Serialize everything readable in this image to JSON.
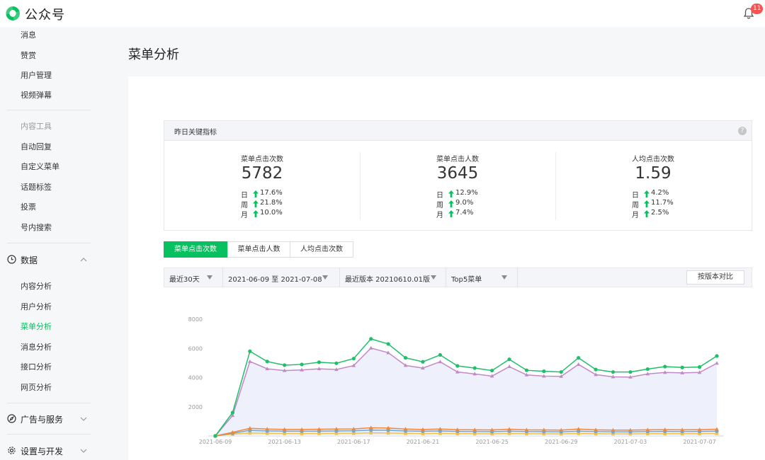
{
  "header": {
    "brand": "公众号",
    "notification_count": "11"
  },
  "colors": {
    "accent": "#07c160",
    "badge": "#fa5151",
    "up_arrow": "#07c160"
  },
  "sidebar": {
    "top_items": [
      "消息",
      "赞赏",
      "用户管理",
      "视频弹幕"
    ],
    "content_tools_section": "内容工具",
    "content_tools": [
      "自动回复",
      "自定义菜单",
      "话题标签",
      "投票",
      "号内搜索"
    ],
    "data_group": {
      "label": "数据",
      "icon": "clock-icon",
      "expanded": true
    },
    "data_items": [
      "内容分析",
      "用户分析",
      "菜单分析",
      "消息分析",
      "接口分析",
      "网页分析"
    ],
    "active_item": "菜单分析",
    "ads_group": {
      "label": "广告与服务",
      "icon": "compass-icon"
    },
    "settings_group": {
      "label": "设置与开发",
      "icon": "gear-icon"
    }
  },
  "main": {
    "page_title": "菜单分析",
    "kpi": {
      "header": "昨日关键指标",
      "cards": [
        {
          "title": "菜单点击次数",
          "value": "5782",
          "rows": [
            {
              "k": "日",
              "v": "17.6%"
            },
            {
              "k": "周",
              "v": "21.8%"
            },
            {
              "k": "月",
              "v": "10.0%"
            }
          ]
        },
        {
          "title": "菜单点击人数",
          "value": "3645",
          "rows": [
            {
              "k": "日",
              "v": "12.9%"
            },
            {
              "k": "周",
              "v": "9.0%"
            },
            {
              "k": "月",
              "v": "7.4%"
            }
          ]
        },
        {
          "title": "人均点击次数",
          "value": "1.59",
          "rows": [
            {
              "k": "日",
              "v": "4.2%"
            },
            {
              "k": "周",
              "v": "11.7%"
            },
            {
              "k": "月",
              "v": "2.5%"
            }
          ]
        }
      ]
    },
    "tabs": [
      "菜单点击次数",
      "菜单点击人数",
      "人均点击次数"
    ],
    "active_tab": "菜单点击次数",
    "filters": {
      "range": "最近30天",
      "dates": "2021-06-09 至 2021-07-08",
      "version": "最近版本 20210610.01版",
      "top": "Top5菜单",
      "compare_button": "按版本对比"
    }
  },
  "chart_data": {
    "type": "line",
    "x": [
      "2021-06-09",
      "2021-06-10",
      "2021-06-11",
      "2021-06-12",
      "2021-06-13",
      "2021-06-14",
      "2021-06-15",
      "2021-06-16",
      "2021-06-17",
      "2021-06-18",
      "2021-06-19",
      "2021-06-20",
      "2021-06-21",
      "2021-06-22",
      "2021-06-23",
      "2021-06-24",
      "2021-06-25",
      "2021-06-26",
      "2021-06-27",
      "2021-06-28",
      "2021-06-29",
      "2021-06-30",
      "2021-07-01",
      "2021-07-02",
      "2021-07-03",
      "2021-07-04",
      "2021-07-05",
      "2021-07-06",
      "2021-07-07",
      "2021-07-08"
    ],
    "xticks": [
      "2021-06-09",
      "2021-06-13",
      "2021-06-17",
      "2021-06-21",
      "2021-06-25",
      "2021-06-29",
      "2021-07-03",
      "2021-07-07"
    ],
    "yticks": [
      2000,
      4000,
      6000,
      8000
    ],
    "ylim": [
      0,
      8000
    ],
    "grid": false,
    "series": [
      {
        "color": "#1fbf6a",
        "marker": "circle",
        "area": false,
        "values": [
          0,
          1600,
          5800,
          5100,
          4850,
          4900,
          5050,
          4980,
          5300,
          6650,
          6300,
          5350,
          5080,
          5550,
          4800,
          4650,
          4480,
          5250,
          4500,
          4430,
          4380,
          5350,
          4550,
          4380,
          4380,
          4580,
          4750,
          4690,
          4720,
          5480
        ]
      },
      {
        "color": "#c08ac6",
        "marker": "triangle",
        "area": true,
        "values": [
          0,
          1400,
          5100,
          4600,
          4480,
          4520,
          4600,
          4550,
          4820,
          6020,
          5700,
          4830,
          4650,
          5080,
          4380,
          4250,
          4100,
          4750,
          4180,
          4100,
          4080,
          4900,
          4200,
          4050,
          4030,
          4250,
          4350,
          4320,
          4350,
          4980
        ]
      },
      {
        "color": "#f0873a",
        "marker": "triangle",
        "area": false,
        "values": [
          0,
          250,
          520,
          470,
          450,
          440,
          460,
          470,
          480,
          560,
          540,
          470,
          440,
          470,
          430,
          420,
          410,
          460,
          420,
          410,
          400,
          470,
          420,
          400,
          400,
          420,
          430,
          420,
          430,
          460
        ]
      },
      {
        "color": "#6fa8d8",
        "marker": "circle",
        "area": false,
        "values": [
          0,
          180,
          380,
          340,
          330,
          320,
          330,
          340,
          350,
          400,
          390,
          340,
          320,
          340,
          310,
          300,
          290,
          330,
          300,
          290,
          280,
          330,
          300,
          280,
          280,
          300,
          310,
          300,
          310,
          330
        ]
      },
      {
        "color": "#f2c34b",
        "marker": "square",
        "area": false,
        "values": [
          0,
          120,
          200,
          180,
          170,
          165,
          170,
          175,
          180,
          210,
          200,
          175,
          165,
          175,
          160,
          155,
          150,
          170,
          155,
          150,
          145,
          170,
          155,
          145,
          145,
          155,
          160,
          155,
          160,
          170
        ]
      }
    ]
  }
}
